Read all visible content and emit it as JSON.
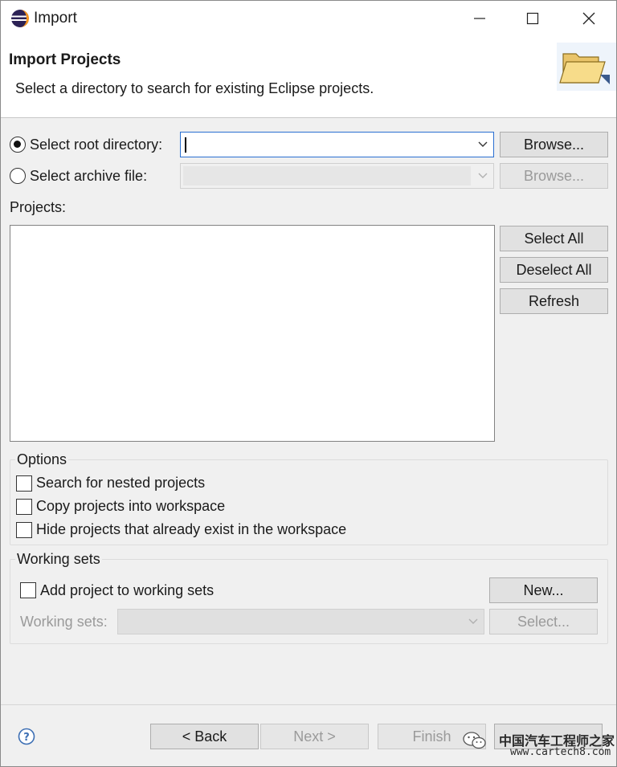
{
  "window": {
    "title": "Import",
    "icon": "eclipse-icon"
  },
  "banner": {
    "title": "Import Projects",
    "description": "Select a directory to search for existing Eclipse projects.",
    "image": "folder-icon"
  },
  "source": {
    "root_directory_label": "Select root directory:",
    "root_directory_value": "",
    "root_directory_selected": true,
    "archive_file_label": "Select archive file:",
    "archive_file_value": "",
    "archive_file_selected": false,
    "browse_label": "Browse..."
  },
  "projects": {
    "label": "Projects:",
    "items": [],
    "select_all_label": "Select All",
    "deselect_all_label": "Deselect All",
    "refresh_label": "Refresh"
  },
  "options": {
    "title": "Options",
    "items": [
      {
        "label": "Search for nested projects",
        "checked": false
      },
      {
        "label": "Copy projects into workspace",
        "checked": false
      },
      {
        "label": "Hide projects that already exist in the workspace",
        "checked": false
      }
    ]
  },
  "working_sets": {
    "title": "Working sets",
    "add_label": "Add project to working sets",
    "add_checked": false,
    "new_label": "New...",
    "sets_label": "Working sets:",
    "select_label": "Select..."
  },
  "footer": {
    "back_label": "< Back",
    "next_label": "Next >",
    "finish_label": "Finish"
  },
  "watermark": {
    "line1": "中国汽车工程师之家",
    "line2": "www.cartech8.com"
  },
  "colors": {
    "focus_border": "#2a6fd1",
    "dialog_bg": "#f0f0f0",
    "button_bg": "#e1e1e1",
    "disabled_text": "#9a9a9a"
  }
}
